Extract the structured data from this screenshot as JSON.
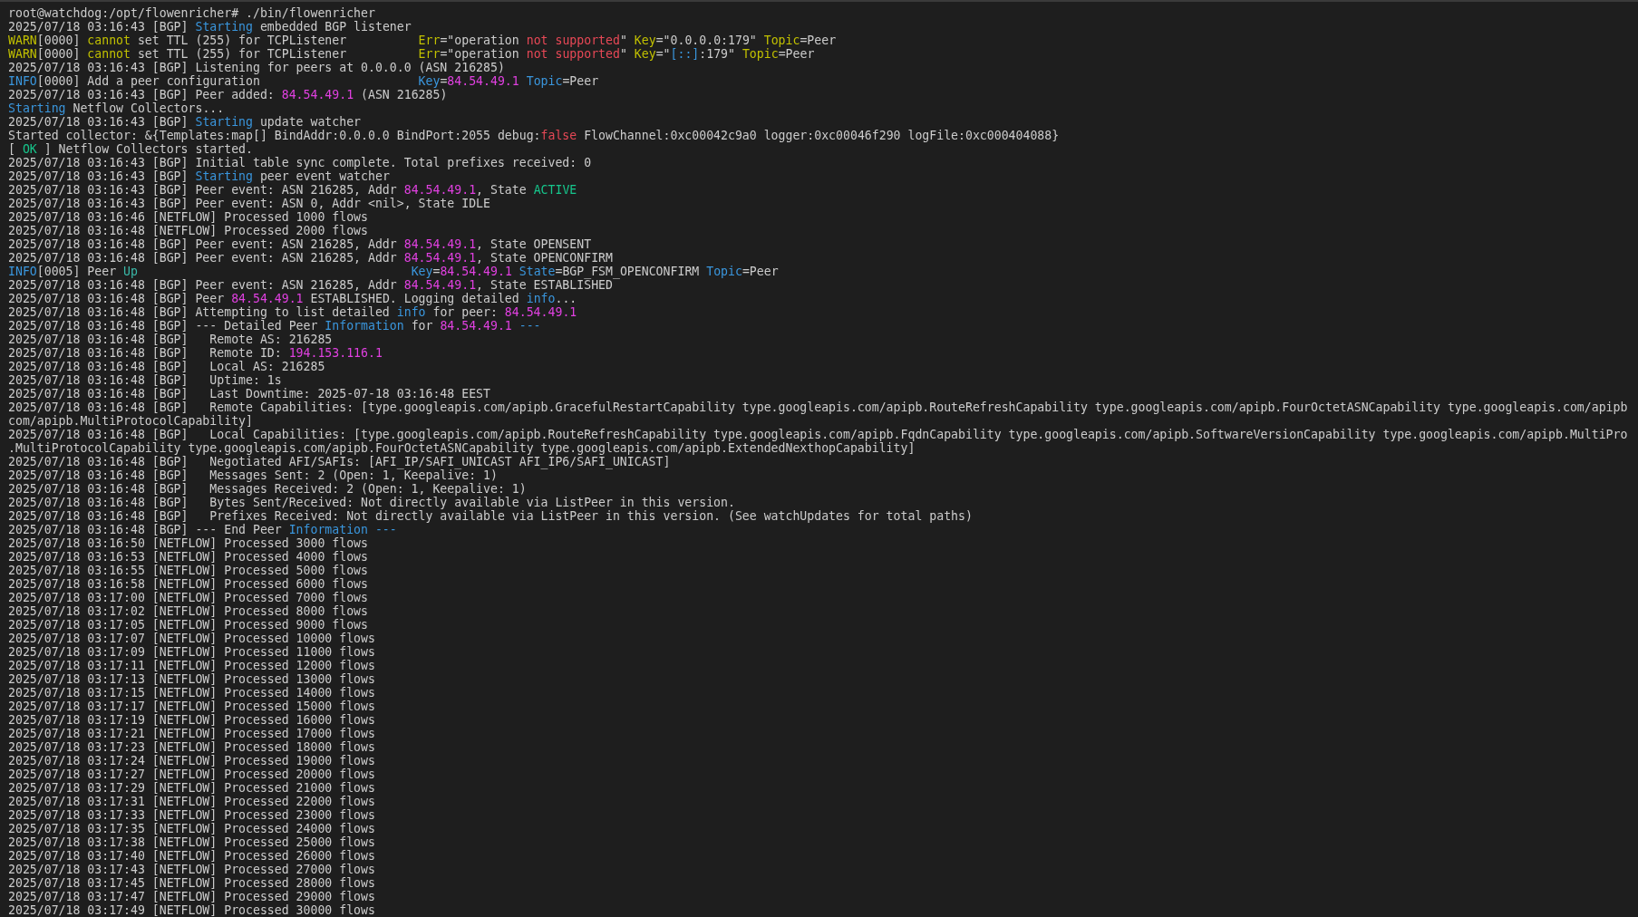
{
  "terminal": {
    "lines": [
      {
        "spans": [
          {
            "text": "root@watchdog:/opt/flowenricher# ./bin/flowenricher"
          }
        ]
      },
      {
        "spans": [
          {
            "text": "2025/07/18 03:16:43 [BGP] "
          },
          {
            "text": "Starting",
            "color": "#3a96dd"
          },
          {
            "text": " embedded BGP listener"
          }
        ]
      },
      {
        "spans": [
          {
            "text": "WARN",
            "color": "#c1c000"
          },
          {
            "text": "[0000] "
          },
          {
            "text": "cannot",
            "color": "#c1c000"
          },
          {
            "text": " set TTL (255) for TCPListener          "
          },
          {
            "text": "Err",
            "color": "#c1c000"
          },
          {
            "text": "=\"operation "
          },
          {
            "text": "not supported",
            "color": "#e74856"
          },
          {
            "text": "\" "
          },
          {
            "text": "Key",
            "color": "#c1c000"
          },
          {
            "text": "=\"0.0.0.0:179\" "
          },
          {
            "text": "Topic",
            "color": "#c1c000"
          },
          {
            "text": "=Peer"
          }
        ]
      },
      {
        "spans": [
          {
            "text": "WARN",
            "color": "#c1c000"
          },
          {
            "text": "[0000] "
          },
          {
            "text": "cannot",
            "color": "#c1c000"
          },
          {
            "text": " set TTL (255) for TCPListener          "
          },
          {
            "text": "Err",
            "color": "#c1c000"
          },
          {
            "text": "=\"operation "
          },
          {
            "text": "not supported",
            "color": "#e74856"
          },
          {
            "text": "\" "
          },
          {
            "text": "Key",
            "color": "#c1c000"
          },
          {
            "text": "=\""
          },
          {
            "text": "[::]",
            "color": "#3a96dd"
          },
          {
            "text": ":179\" "
          },
          {
            "text": "Topic",
            "color": "#c1c000"
          },
          {
            "text": "=Peer"
          }
        ]
      },
      {
        "spans": [
          {
            "text": "2025/07/18 03:16:43 [BGP] Listening for peers at 0.0.0.0 (ASN 216285)"
          }
        ]
      },
      {
        "spans": [
          {
            "text": "INFO",
            "color": "#3a96dd"
          },
          {
            "text": "[0000] Add a peer configuration                      "
          },
          {
            "text": "Key",
            "color": "#3a96dd"
          },
          {
            "text": "="
          },
          {
            "text": "84.54.49.1 ",
            "color": "#e040e0"
          },
          {
            "text": "Topic",
            "color": "#3a96dd"
          },
          {
            "text": "=Peer"
          }
        ]
      },
      {
        "spans": [
          {
            "text": "2025/07/18 03:16:43 [BGP] Peer added: "
          },
          {
            "text": "84.54.49.1",
            "color": "#e040e0"
          },
          {
            "text": " (ASN 216285)"
          }
        ]
      },
      {
        "spans": [
          {
            "text": "Starting",
            "color": "#3a96dd"
          },
          {
            "text": " Netflow Collectors..."
          }
        ]
      },
      {
        "spans": [
          {
            "text": "2025/07/18 03:16:43 [BGP] "
          },
          {
            "text": "Starting",
            "color": "#3a96dd"
          },
          {
            "text": " update watcher"
          }
        ]
      },
      {
        "spans": [
          {
            "text": "Started collector: &{Templates:map[] BindAddr:0.0.0.0 BindPort:2055 debug:"
          },
          {
            "text": "false",
            "color": "#e74856"
          },
          {
            "text": " FlowChannel:0xc00042c9a0 logger:0xc00046f290 logFile:0xc000404088}"
          }
        ]
      },
      {
        "spans": [
          {
            "text": "[ "
          },
          {
            "text": "OK",
            "color": "#16c68c"
          },
          {
            "text": " ] Netflow Collectors started."
          }
        ]
      },
      {
        "spans": [
          {
            "text": "2025/07/18 03:16:43 [BGP] Initial table sync complete. Total prefixes received: 0"
          }
        ]
      },
      {
        "spans": [
          {
            "text": "2025/07/18 03:16:43 [BGP] "
          },
          {
            "text": "Starting",
            "color": "#3a96dd"
          },
          {
            "text": " peer event watcher"
          }
        ]
      },
      {
        "spans": [
          {
            "text": "2025/07/18 03:16:43 [BGP] Peer event: ASN 216285, Addr "
          },
          {
            "text": "84.54.49.1",
            "color": "#e040e0"
          },
          {
            "text": ", State "
          },
          {
            "text": "ACTIVE",
            "color": "#16c68c"
          }
        ]
      },
      {
        "spans": [
          {
            "text": "2025/07/18 03:16:43 [BGP] Peer event: ASN 0, Addr <nil>, State IDLE"
          }
        ]
      },
      {
        "spans": [
          {
            "text": "2025/07/18 03:16:46 [NETFLOW] Processed 1000 flows"
          }
        ]
      },
      {
        "spans": [
          {
            "text": "2025/07/18 03:16:48 [NETFLOW] Processed 2000 flows"
          }
        ]
      },
      {
        "spans": [
          {
            "text": "2025/07/18 03:16:48 [BGP] Peer event: ASN 216285, Addr "
          },
          {
            "text": "84.54.49.1",
            "color": "#e040e0"
          },
          {
            "text": ", State OPENSENT"
          }
        ]
      },
      {
        "spans": [
          {
            "text": "2025/07/18 03:16:48 [BGP] Peer event: ASN 216285, Addr "
          },
          {
            "text": "84.54.49.1",
            "color": "#e040e0"
          },
          {
            "text": ", State OPENCONFIRM"
          }
        ]
      },
      {
        "spans": [
          {
            "text": "INFO",
            "color": "#3a96dd"
          },
          {
            "text": "[0005] Peer "
          },
          {
            "text": "Up                                      ",
            "color": "#3ab8a8"
          },
          {
            "text": "Key",
            "color": "#3a96dd"
          },
          {
            "text": "="
          },
          {
            "text": "84.54.49.1 ",
            "color": "#e040e0"
          },
          {
            "text": "State",
            "color": "#3a96dd"
          },
          {
            "text": "=BGP_FSM_OPENCONFIRM "
          },
          {
            "text": "Topic",
            "color": "#3a96dd"
          },
          {
            "text": "=Peer"
          }
        ]
      },
      {
        "spans": [
          {
            "text": "2025/07/18 03:16:48 [BGP] Peer event: ASN 216285, Addr "
          },
          {
            "text": "84.54.49.1",
            "color": "#e040e0"
          },
          {
            "text": ", State ESTABLISHED"
          }
        ]
      },
      {
        "spans": [
          {
            "text": "2025/07/18 03:16:48 [BGP] Peer "
          },
          {
            "text": "84.54.49.1",
            "color": "#e040e0"
          },
          {
            "text": " ESTABLISHED. Logging detailed "
          },
          {
            "text": "info",
            "color": "#3a96dd"
          },
          {
            "text": "..."
          }
        ]
      },
      {
        "spans": [
          {
            "text": "2025/07/18 03:16:48 [BGP] Attempting to list detailed "
          },
          {
            "text": "info",
            "color": "#3a96dd"
          },
          {
            "text": " for peer: "
          },
          {
            "text": "84.54.49.1",
            "color": "#e040e0"
          }
        ]
      },
      {
        "spans": [
          {
            "text": "2025/07/18 03:16:48 [BGP] --- Detailed Peer "
          },
          {
            "text": "Information",
            "color": "#3a96dd"
          },
          {
            "text": " for "
          },
          {
            "text": "84.54.49.1 ",
            "color": "#e040e0"
          },
          {
            "text": "---",
            "color": "#3a96dd"
          }
        ]
      },
      {
        "spans": [
          {
            "text": "2025/07/18 03:16:48 [BGP]   Remote AS: 216285"
          }
        ]
      },
      {
        "spans": [
          {
            "text": "2025/07/18 03:16:48 [BGP]   Remote ID: "
          },
          {
            "text": "194.153.116.1",
            "color": "#e040e0"
          }
        ]
      },
      {
        "spans": [
          {
            "text": "2025/07/18 03:16:48 [BGP]   Local AS: 216285"
          }
        ]
      },
      {
        "spans": [
          {
            "text": "2025/07/18 03:16:48 [BGP]   Uptime: 1s"
          }
        ]
      },
      {
        "spans": [
          {
            "text": "2025/07/18 03:16:48 [BGP]   Last Downtime: 2025-07-18 03:16:48 EEST"
          }
        ]
      },
      {
        "spans": [
          {
            "text": "2025/07/18 03:16:48 [BGP]   Remote Capabilities: [type.googleapis.com/apipb.GracefulRestartCapability type.googleapis.com/apipb.RouteRefreshCapability type.googleapis.com/apipb.FourOctetASNCapability type.googleapis.com/apipb"
          }
        ]
      },
      {
        "spans": [
          {
            "text": "com/apipb.MultiProtocolCapability]"
          }
        ]
      },
      {
        "spans": [
          {
            "text": "2025/07/18 03:16:48 [BGP]   Local Capabilities: [type.googleapis.com/apipb.RouteRefreshCapability type.googleapis.com/apipb.FqdnCapability type.googleapis.com/apipb.SoftwareVersionCapability type.googleapis.com/apipb.MultiPro"
          }
        ]
      },
      {
        "spans": [
          {
            "text": ".MultiProtocolCapability type.googleapis.com/apipb.FourOctetASNCapability type.googleapis.com/apipb.ExtendedNexthopCapability]"
          }
        ]
      },
      {
        "spans": [
          {
            "text": "2025/07/18 03:16:48 [BGP]   Negotiated AFI/SAFIs: [AFI_IP/SAFI_UNICAST AFI_IP6/SAFI_UNICAST]"
          }
        ]
      },
      {
        "spans": [
          {
            "text": "2025/07/18 03:16:48 [BGP]   Messages Sent: 2 (Open: 1, Keepalive: 1)"
          }
        ]
      },
      {
        "spans": [
          {
            "text": "2025/07/18 03:16:48 [BGP]   Messages Received: 2 (Open: 1, Keepalive: 1)"
          }
        ]
      },
      {
        "spans": [
          {
            "text": "2025/07/18 03:16:48 [BGP]   Bytes Sent/Received: Not directly available via ListPeer in this version."
          }
        ]
      },
      {
        "spans": [
          {
            "text": "2025/07/18 03:16:48 [BGP]   Prefixes Received: Not directly available via ListPeer in this version. (See watchUpdates for total paths)"
          }
        ]
      },
      {
        "spans": [
          {
            "text": "2025/07/18 03:16:48 [BGP] --- End Peer "
          },
          {
            "text": "Information ---",
            "color": "#3a96dd"
          }
        ]
      },
      {
        "spans": [
          {
            "text": "2025/07/18 03:16:50 [NETFLOW] Processed 3000 flows"
          }
        ]
      },
      {
        "spans": [
          {
            "text": "2025/07/18 03:16:53 [NETFLOW] Processed 4000 flows"
          }
        ]
      },
      {
        "spans": [
          {
            "text": "2025/07/18 03:16:55 [NETFLOW] Processed 5000 flows"
          }
        ]
      },
      {
        "spans": [
          {
            "text": "2025/07/18 03:16:58 [NETFLOW] Processed 6000 flows"
          }
        ]
      },
      {
        "spans": [
          {
            "text": "2025/07/18 03:17:00 [NETFLOW] Processed 7000 flows"
          }
        ]
      },
      {
        "spans": [
          {
            "text": "2025/07/18 03:17:02 [NETFLOW] Processed 8000 flows"
          }
        ]
      },
      {
        "spans": [
          {
            "text": "2025/07/18 03:17:05 [NETFLOW] Processed 9000 flows"
          }
        ]
      },
      {
        "spans": [
          {
            "text": "2025/07/18 03:17:07 [NETFLOW] Processed 10000 flows"
          }
        ]
      },
      {
        "spans": [
          {
            "text": "2025/07/18 03:17:09 [NETFLOW] Processed 11000 flows"
          }
        ]
      },
      {
        "spans": [
          {
            "text": "2025/07/18 03:17:11 [NETFLOW] Processed 12000 flows"
          }
        ]
      },
      {
        "spans": [
          {
            "text": "2025/07/18 03:17:13 [NETFLOW] Processed 13000 flows"
          }
        ]
      },
      {
        "spans": [
          {
            "text": "2025/07/18 03:17:15 [NETFLOW] Processed 14000 flows"
          }
        ]
      },
      {
        "spans": [
          {
            "text": "2025/07/18 03:17:17 [NETFLOW] Processed 15000 flows"
          }
        ]
      },
      {
        "spans": [
          {
            "text": "2025/07/18 03:17:19 [NETFLOW] Processed 16000 flows"
          }
        ]
      },
      {
        "spans": [
          {
            "text": "2025/07/18 03:17:21 [NETFLOW] Processed 17000 flows"
          }
        ]
      },
      {
        "spans": [
          {
            "text": "2025/07/18 03:17:23 [NETFLOW] Processed 18000 flows"
          }
        ]
      },
      {
        "spans": [
          {
            "text": "2025/07/18 03:17:24 [NETFLOW] Processed 19000 flows"
          }
        ]
      },
      {
        "spans": [
          {
            "text": "2025/07/18 03:17:27 [NETFLOW] Processed 20000 flows"
          }
        ]
      },
      {
        "spans": [
          {
            "text": "2025/07/18 03:17:29 [NETFLOW] Processed 21000 flows"
          }
        ]
      },
      {
        "spans": [
          {
            "text": "2025/07/18 03:17:31 [NETFLOW] Processed 22000 flows"
          }
        ]
      },
      {
        "spans": [
          {
            "text": "2025/07/18 03:17:33 [NETFLOW] Processed 23000 flows"
          }
        ]
      },
      {
        "spans": [
          {
            "text": "2025/07/18 03:17:35 [NETFLOW] Processed 24000 flows"
          }
        ]
      },
      {
        "spans": [
          {
            "text": "2025/07/18 03:17:38 [NETFLOW] Processed 25000 flows"
          }
        ]
      },
      {
        "spans": [
          {
            "text": "2025/07/18 03:17:40 [NETFLOW] Processed 26000 flows"
          }
        ]
      },
      {
        "spans": [
          {
            "text": "2025/07/18 03:17:43 [NETFLOW] Processed 27000 flows"
          }
        ]
      },
      {
        "spans": [
          {
            "text": "2025/07/18 03:17:45 [NETFLOW] Processed 28000 flows"
          }
        ]
      },
      {
        "spans": [
          {
            "text": "2025/07/18 03:17:47 [NETFLOW] Processed 29000 flows"
          }
        ]
      },
      {
        "spans": [
          {
            "text": "2025/07/18 03:17:49 [NETFLOW] Processed 30000 flows"
          }
        ]
      }
    ]
  }
}
